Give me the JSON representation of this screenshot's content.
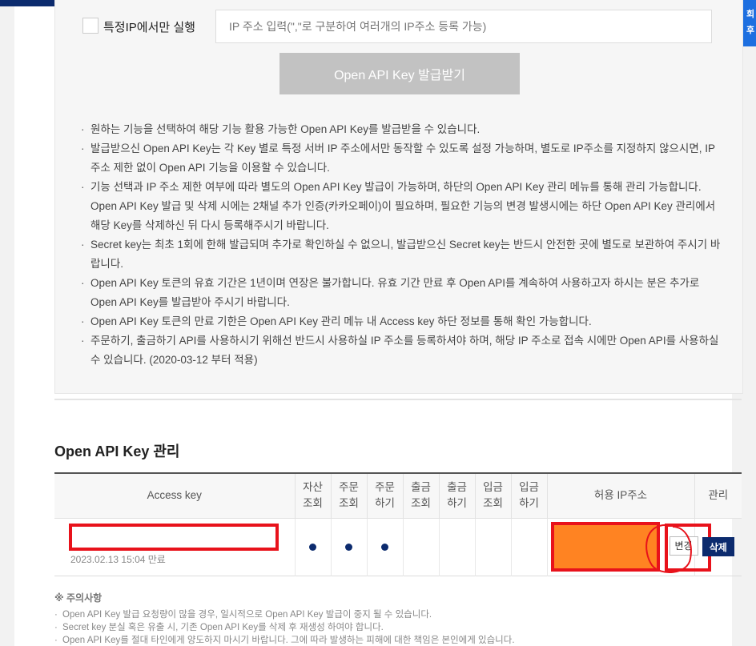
{
  "side_tab_text": "회 후",
  "ip_restrict": {
    "checkbox_label": "특정IP에서만 실행",
    "placeholder": "IP 주소 입력(\",\"로 구분하여 여러개의 IP주소 등록 가능)"
  },
  "issue_button_label": "Open API Key 발급받기",
  "notes": [
    "원하는 기능을 선택하여 해당 기능 활용 가능한 Open API Key를 발급받을 수 있습니다.",
    "발급받으신 Open API Key는 각 Key 별로 특정 서버 IP 주소에서만 동작할 수 있도록 설정 가능하며, 별도로 IP주소를 지정하지 않으시면, IP 주소 제한 없이 Open API 기능을 이용할 수 있습니다.",
    "기능 선택과 IP 주소 제한 여부에 따라 별도의 Open API Key 발급이 가능하며, 하단의 Open API Key 관리 메뉴를 통해 관리 가능합니다. Open API Key 발급 및 삭제 시에는 2채널 추가 인증(카카오페이)이 필요하며, 필요한 기능의 변경 발생시에는 하단 Open API Key 관리에서 해당 Key를 삭제하신 뒤 다시 등록해주시기 바랍니다.",
    "Secret key는 최초 1회에 한해 발급되며 추가로 확인하실 수 없으니, 발급받으신 Secret key는 반드시 안전한 곳에 별도로 보관하여 주시기 바랍니다.",
    "Open API Key 토큰의 유효 기간은 1년이며 연장은 불가합니다. 유효 기간 만료 후 Open API를 계속하여 사용하고자 하시는 분은 추가로 Open API Key를 발급받아 주시기 바랍니다.",
    "Open API Key 토큰의 만료 기한은 Open API Key 관리 메뉴 내 Access key 하단 정보를 통해 확인 가능합니다.",
    "주문하기, 출금하기 API를 사용하시기 위해선 반드시 사용하실 IP 주소를 등록하셔야 하며, 해당 IP 주소로 접속 시에만 Open API를 사용하실 수 있습니다. (2020-03-12 부터 적용)"
  ],
  "management": {
    "title": "Open API Key 관리",
    "headers": {
      "access_key": "Access key",
      "asset_view_1": "자산",
      "asset_view_2": "조회",
      "order_view_1": "주문",
      "order_view_2": "조회",
      "order_place_1": "주문",
      "order_place_2": "하기",
      "withdraw_view_1": "출금",
      "withdraw_view_2": "조회",
      "withdraw_do_1": "출금",
      "withdraw_do_2": "하기",
      "deposit_view_1": "입금",
      "deposit_view_2": "조회",
      "deposit_do_1": "입금",
      "deposit_do_2": "하기",
      "allowed_ip": "허용 IP주소",
      "manage": "관리"
    },
    "row": {
      "expire": "2023.02.13 15:04 만료",
      "change_label": "변경",
      "delete_label": "삭제",
      "permissions": {
        "asset_view": true,
        "order_view": true,
        "order_place": true,
        "withdraw_view": false,
        "withdraw_do": false,
        "deposit_view": false,
        "deposit_do": false
      }
    }
  },
  "caution": {
    "title": "※ 주의사항",
    "items": [
      "Open API Key 발급 요청량이 많을 경우, 일시적으로 Open API Key 발급이 중지 될 수 있습니다.",
      "Secret key 분실 혹은 유출 시, 기존 Open API Key를 삭제 후 재생성 하여야 합니다.",
      "Open API Key를 절대 타인에게 양도하지 마시기 바랍니다. 그에 따라 발생하는 피해에 대한 책임은 본인에게 있습니다."
    ]
  },
  "colors": {
    "navy": "#0c2b6e",
    "side_tab": "#1d6fe0",
    "disabled_button": "#c2c2c2",
    "annotation_red": "#e8121b",
    "ip_redaction": "#ff8322"
  }
}
